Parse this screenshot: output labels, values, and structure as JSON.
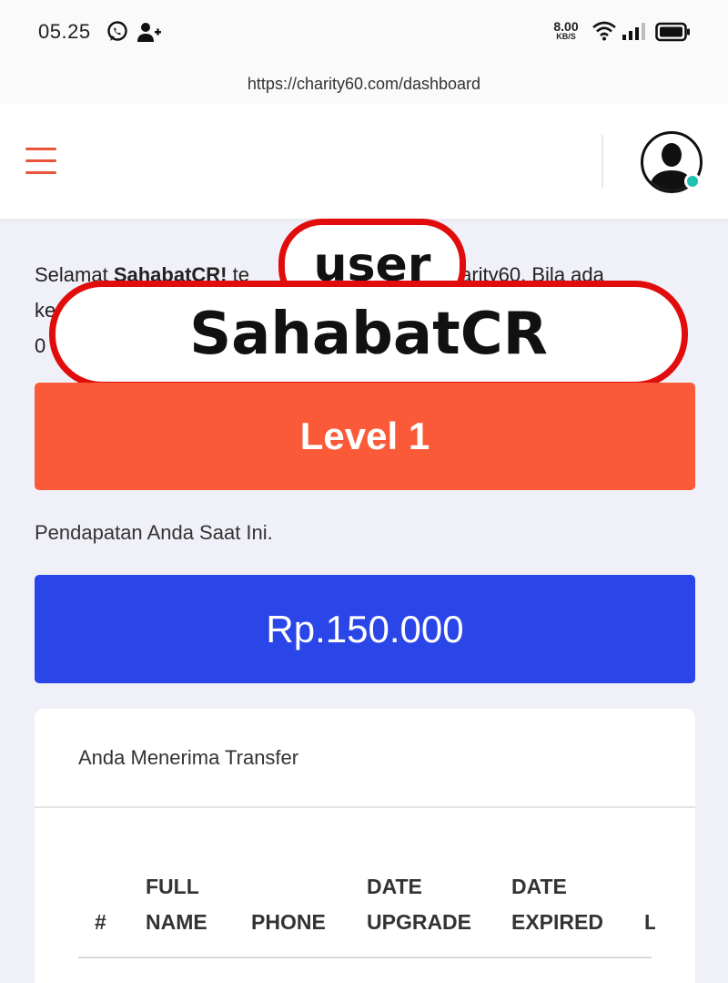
{
  "status_bar": {
    "time": "05.25",
    "speed_value": "8.00",
    "speed_unit": "KB/S"
  },
  "browser": {
    "url": "https://charity60.com/dashboard"
  },
  "nav": {
    "menu_icon": "hamburger-menu-icon",
    "avatar_icon": "user-avatar-icon",
    "status_color": "#1ec0b0"
  },
  "welcome": {
    "prefix": "Selamat ",
    "username": "SahabatCR!",
    "rest": " te",
    "line1_end": "Charity60. Bila ada",
    "line2_start": "ke",
    "line3_start": "0"
  },
  "annotations": {
    "user_label": "user",
    "name_label": "SahabatCR",
    "color": "#e10d0d"
  },
  "level": {
    "label": "Level 1",
    "color": "#fb5a38"
  },
  "income": {
    "label": "Pendapatan Anda Saat Ini.",
    "amount": "Rp.150.000",
    "color": "#2b46e8"
  },
  "transfer_card": {
    "title": "Anda Menerima Transfer",
    "columns": [
      "#",
      "FULL NAME",
      "PHONE",
      "DATE UPGRADE",
      "DATE EXPIRED",
      "L"
    ]
  }
}
